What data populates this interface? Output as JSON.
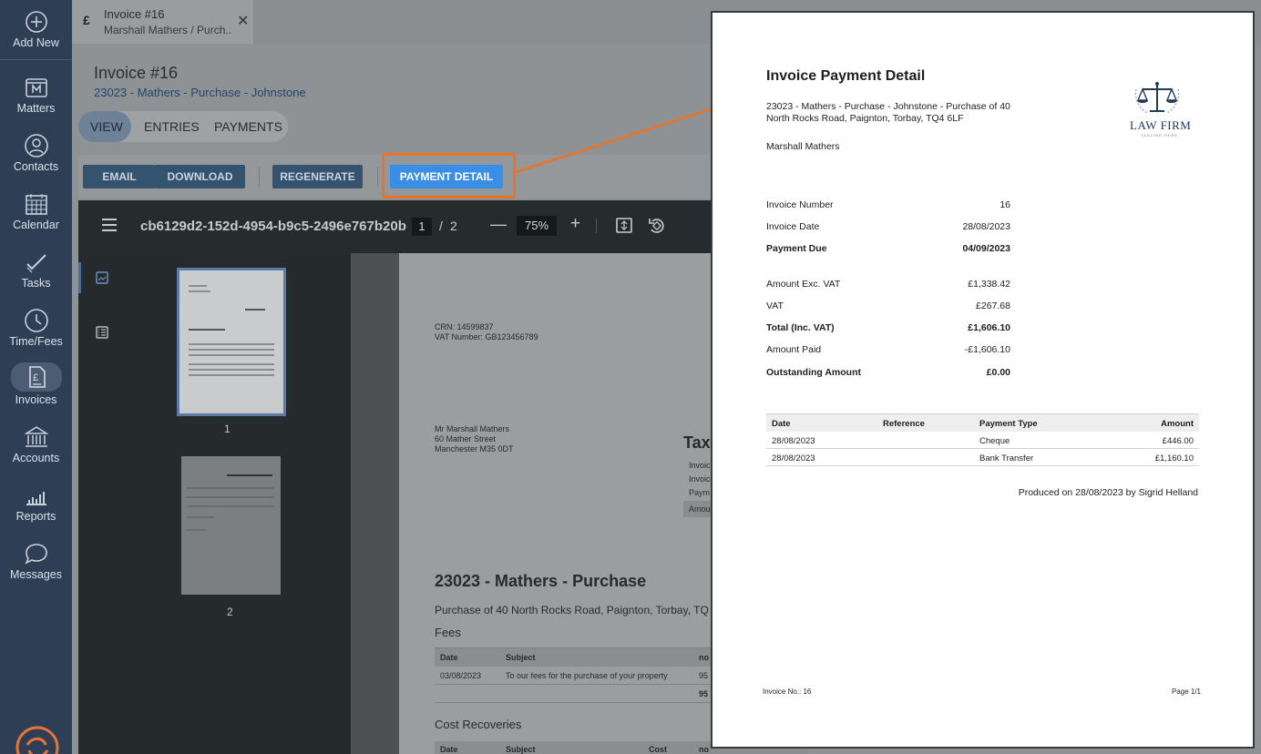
{
  "sidebar": {
    "add_new": "Add New",
    "items": [
      {
        "label": "Matters",
        "icon": "folder-m-icon"
      },
      {
        "label": "Contacts",
        "icon": "person-icon"
      },
      {
        "label": "Calendar",
        "icon": "calendar-icon"
      },
      {
        "label": "Tasks",
        "icon": "check-icon"
      },
      {
        "label": "Time/Fees",
        "icon": "clock-icon"
      },
      {
        "label": "Invoices",
        "icon": "invoice-icon"
      },
      {
        "label": "Accounts",
        "icon": "bank-icon"
      },
      {
        "label": "Reports",
        "icon": "bar-chart-icon"
      },
      {
        "label": "Messages",
        "icon": "chat-bubble-icon"
      }
    ]
  },
  "tab": {
    "currency": "£",
    "title": "Invoice #16",
    "subtitle": "Marshall Mathers / Purch..."
  },
  "header": {
    "title": "Invoice #16",
    "matter_link": "23023 - Mathers - Purchase - Johnstone"
  },
  "segments": {
    "view": "VIEW",
    "entries": "ENTRIES",
    "payments": "PAYMENTS"
  },
  "toolbar": {
    "email": "EMAIL",
    "download": "DOWNLOAD",
    "regenerate": "REGENERATE",
    "payment_detail": "PAYMENT DETAIL"
  },
  "pdf_viewer": {
    "filename": "cb6129d2-152d-4954-b9c5-2496e767b20b",
    "page": "1",
    "page_sep": "/",
    "total_pages": "2",
    "zoom": "75%",
    "thumb1_label": "1",
    "thumb2_label": "2"
  },
  "pdf_page": {
    "crn": "CRN: 14599837",
    "vat_number": "VAT Number: GB123456789",
    "addr1": "Mr Marshall Mathers",
    "addr2": "60 Mather Street",
    "addr3": "Manchester M35 0DT",
    "tax": "Tax",
    "inv1": "Invoic",
    "inv2": "Invoic",
    "paym": "Paym",
    "amou": "Amou",
    "matter_heading": "23023 - Mathers - Purchase",
    "matter_desc": "Purchase of 40 North Rocks Road, Paignton, Torbay, TQ",
    "fees": "Fees",
    "fees_head": {
      "date": "Date",
      "subject": "Subject",
      "no": "no"
    },
    "fees_row": {
      "date": "03/08/2023",
      "subject": "To our fees for the purchase of your property",
      "no": "95"
    },
    "fees_total": "95",
    "cost_recoveries": "Cost Recoveries",
    "cost_head": {
      "date": "Date",
      "subject": "Subject",
      "cost": "Cost",
      "no": "no"
    }
  },
  "payment_detail_doc": {
    "title": "Invoice Payment Detail",
    "matter": "23023 - Mathers - Purchase - Johnstone - Purchase of 40 North Rocks Road, Paignton, Torbay, TQ4 6LF",
    "client": "Marshall Mathers",
    "logo_text": "LAW FIRM",
    "logo_tagline": "TAGLINE HERE",
    "invoice_number_label": "Invoice Number",
    "invoice_number": "16",
    "invoice_date_label": "Invoice Date",
    "invoice_date": "28/08/2023",
    "payment_due_label": "Payment Due",
    "payment_due": "04/09/2023",
    "amount_exc_vat_label": "Amount Exc. VAT",
    "amount_exc_vat": "£1,338.42",
    "vat_label": "VAT",
    "vat": "£267.68",
    "total_label": "Total (Inc. VAT)",
    "total": "£1,606.10",
    "amount_paid_label": "Amount Paid",
    "amount_paid": "-£1,606.10",
    "outstanding_label": "Outstanding Amount",
    "outstanding": "£0.00",
    "table_headers": {
      "date": "Date",
      "reference": "Reference",
      "payment_type": "Payment Type",
      "amount": "Amount"
    },
    "payments": [
      {
        "date": "28/08/2023",
        "reference": "",
        "payment_type": "Cheque",
        "amount": "£446.00"
      },
      {
        "date": "28/08/2023",
        "reference": "",
        "payment_type": "Bank Transfer",
        "amount": "£1,160.10"
      }
    ],
    "produced": "Produced on 28/08/2023 by Sigrid Helland",
    "footer_left": "Invoice No.: 16",
    "footer_right": "Page 1/1"
  },
  "colors": {
    "sidebar": "#2d3e55",
    "primary_button": "#3b8ee6",
    "highlight": "#ea7425"
  }
}
